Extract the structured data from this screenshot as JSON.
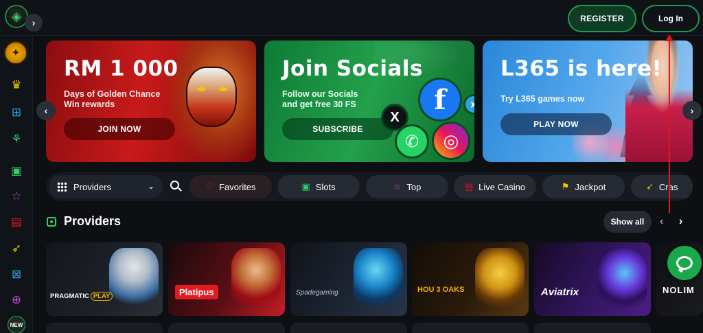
{
  "header": {
    "register_label": "REGISTER",
    "login_label": "Log In",
    "expand_glyph": "›"
  },
  "sidebar": {
    "items": [
      {
        "icon": "chip-icon",
        "color": "#f5b400"
      },
      {
        "icon": "crown-icon",
        "color": "#f5c400"
      },
      {
        "icon": "gift-box-icon",
        "color": "#2aa3e0"
      },
      {
        "icon": "fish-icon",
        "color": "#2ecf6a"
      },
      {
        "icon": "slots-icon",
        "color": "#2ecf6a"
      },
      {
        "icon": "star-icon",
        "color": "#c04ad8"
      },
      {
        "icon": "live-casino-icon",
        "color": "#e0161e"
      },
      {
        "icon": "rocket-icon",
        "color": "#f5c400"
      },
      {
        "icon": "virtual-sports-icon",
        "color": "#2aa3e0"
      },
      {
        "icon": "gift-icon",
        "color": "#c04ad8"
      }
    ],
    "new_badge": "NEW"
  },
  "banners": [
    {
      "title": "RM 1 000",
      "subtitle_line1": "Days of Golden Chance",
      "subtitle_line2": "Win rewards",
      "button": "JOIN NOW"
    },
    {
      "title": "Join Socials",
      "subtitle_line1": "Follow our Socials",
      "subtitle_line2": "and get free 30 FS",
      "button": "SUBSCRIBE"
    },
    {
      "title": "L365 is here!",
      "subtitle_line1": "Try L365 games now",
      "subtitle_line2": "",
      "button": "PLAY NOW"
    }
  ],
  "social_icons": {
    "facebook": "f",
    "x": "X",
    "whatsapp": "✆",
    "instagram": "◎",
    "telegram": "➤"
  },
  "filters": {
    "providers_label": "Providers",
    "chips": [
      {
        "label": "Favorites",
        "icon": "heart-icon",
        "glyph": "♡",
        "color": "#e0161e"
      },
      {
        "label": "Slots",
        "icon": "slots-icon",
        "glyph": "▣",
        "color": "#2ecf6a"
      },
      {
        "label": "Top",
        "icon": "star-icon",
        "glyph": "☆",
        "color": "#c04ad8"
      },
      {
        "label": "Live Casino",
        "icon": "live-casino-icon",
        "glyph": "▤",
        "color": "#e0161e"
      },
      {
        "label": "Jackpot",
        "icon": "jackpot-icon",
        "glyph": "⚑",
        "color": "#f5c400"
      },
      {
        "label": "Cras",
        "icon": "rocket-icon",
        "glyph": "➶",
        "color": "#f5c400"
      }
    ]
  },
  "providers_section": {
    "title": "Providers",
    "show_all_label": "Show all",
    "cards": [
      {
        "name": "PRAGMATIC",
        "suffix": "PLAY"
      },
      {
        "name": "Platipus"
      },
      {
        "name": "Spadegaming"
      },
      {
        "name": "HOU 3 OAKS"
      },
      {
        "name": "Aviatrix"
      },
      {
        "name": "NOLIM"
      }
    ]
  }
}
